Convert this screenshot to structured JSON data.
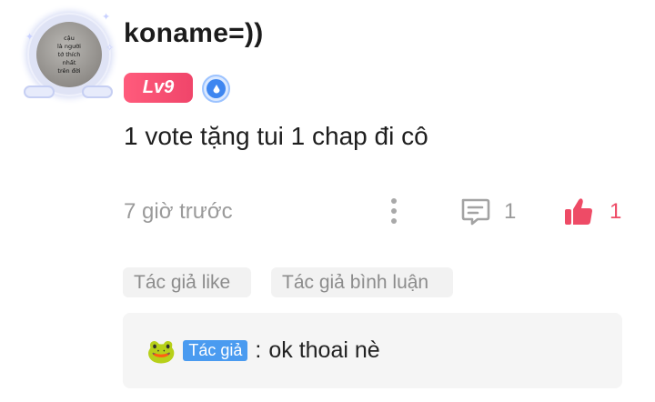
{
  "comment": {
    "username": "koname=))",
    "avatar_text": [
      "cậu",
      "là người",
      "tớ thích",
      "nhất",
      "trên đời"
    ],
    "level_badge": "Lv9",
    "text": "1 vote tặng tui 1 chap đi cô",
    "timestamp": "7 giờ trước",
    "reply_count": "1",
    "like_count": "1"
  },
  "tags": {
    "author_like": "Tác giả like",
    "author_comment": "Tác giả bình luận"
  },
  "reply": {
    "emoji": "🐸",
    "author_badge": "Tác giả",
    "separator": ":",
    "text": "ok thoai nè"
  },
  "colors": {
    "level_badge_bg": "#f0456a",
    "like_accent": "#ee4b66",
    "author_badge_bg": "#4a9bf0"
  },
  "icons": [
    "avatar-frame",
    "rank-badge-icon",
    "more-vertical-icon",
    "comment-icon",
    "thumbs-up-icon"
  ]
}
